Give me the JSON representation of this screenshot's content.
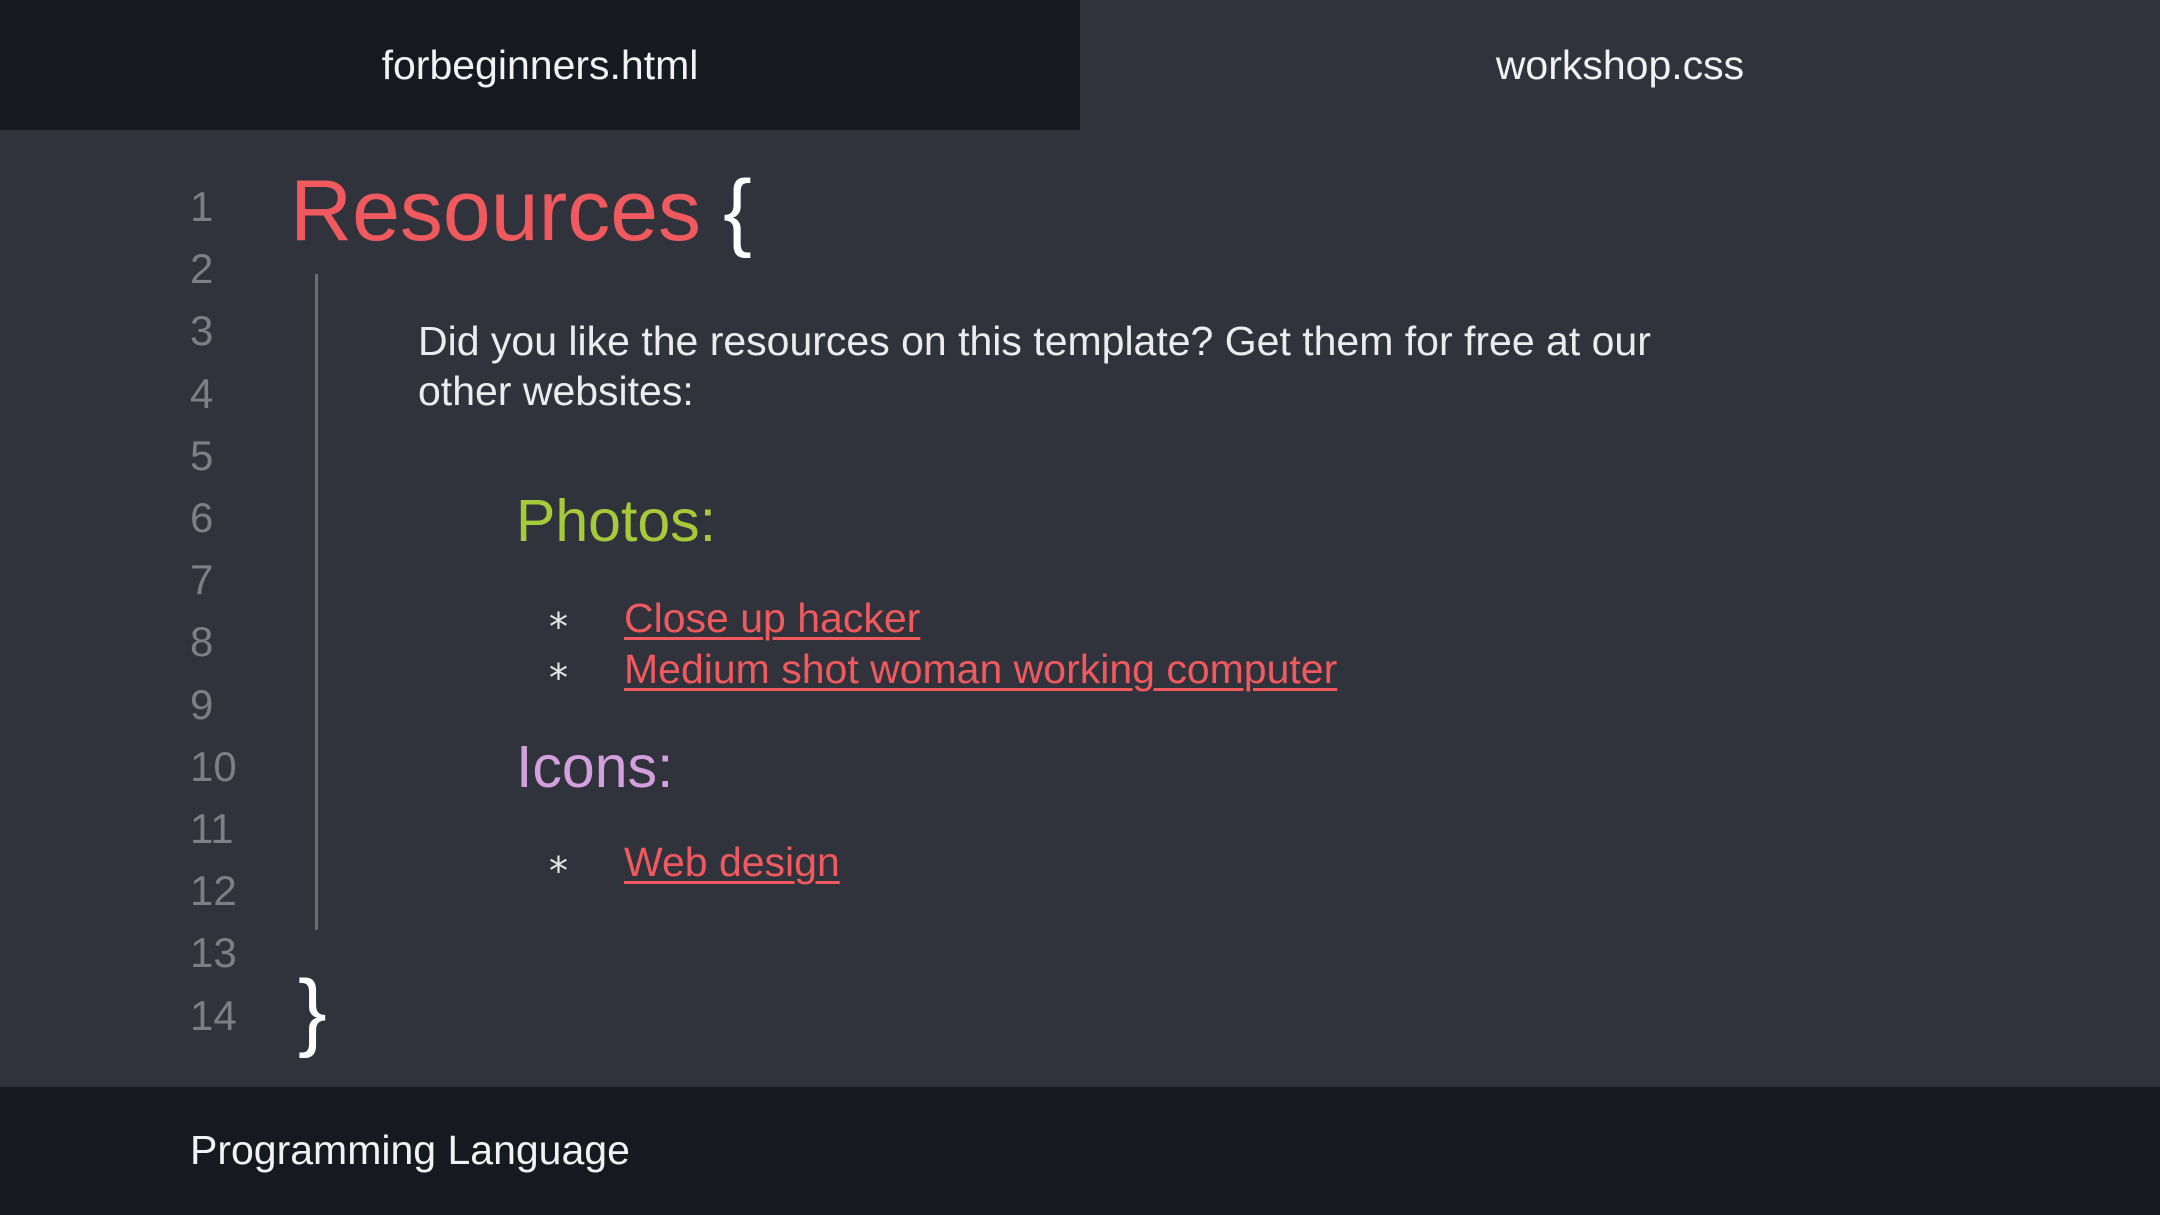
{
  "tabs": [
    {
      "label": "forbeginners.html",
      "active": true
    },
    {
      "label": "workshop.css",
      "active": false
    }
  ],
  "editor": {
    "line_numbers": [
      "1",
      "2",
      "3",
      "4",
      "5",
      "6",
      "7",
      "8",
      "9",
      "10",
      "11",
      "12",
      "13",
      "14"
    ],
    "title_word": "Resources",
    "open_brace": "{",
    "close_brace": "}",
    "intro_text": "Did you like the resources on this template? Get them for free at our other websites:",
    "photos": {
      "heading": "Photos:",
      "bullet": "*",
      "links": [
        "Close up hacker",
        "Medium shot woman working computer"
      ]
    },
    "icons": {
      "heading": "Icons:",
      "bullet": "*",
      "links": [
        "Web design"
      ]
    }
  },
  "footer": {
    "label": "Programming Language"
  },
  "colors": {
    "background": "#30333c",
    "dark_bar": "#171920",
    "title_red": "#f05a5e",
    "photos_green": "#a6cb3a",
    "icons_purple": "#d49fdd",
    "line_number_gray": "#7d7f86"
  }
}
